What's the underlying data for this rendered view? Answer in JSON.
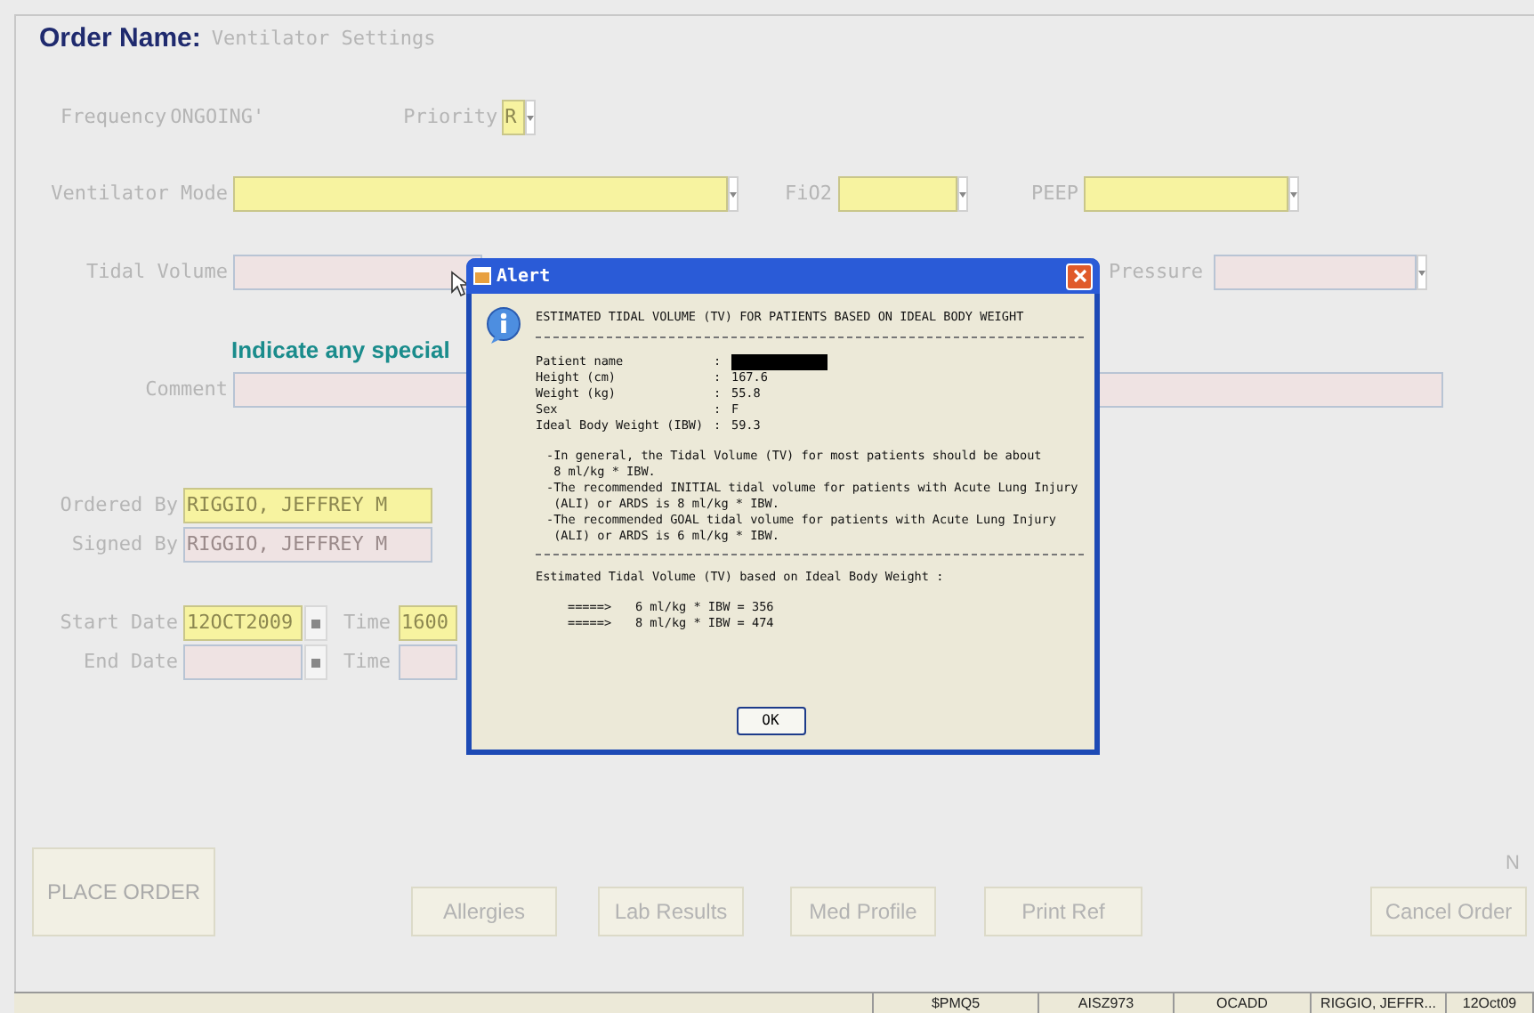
{
  "order_name": {
    "label": "Order Name:",
    "value": "Ventilator Settings"
  },
  "frequency": {
    "label": "Frequency",
    "value": "ONGOING'"
  },
  "priority": {
    "label": "Priority",
    "value": "R",
    "required": true
  },
  "ventilator_row": [
    {
      "label": "Ventilator Mode",
      "required": true,
      "kind": "dropdown"
    },
    {
      "label": "FiO2",
      "required": true,
      "kind": "dropdown"
    },
    {
      "label": "PEEP",
      "required": true,
      "kind": "dropdown"
    }
  ],
  "tidal_volume": {
    "label": "Tidal Volume",
    "required": false
  },
  "pressure": {
    "label": "Pressure",
    "required": false
  },
  "instruction": "Indicate any special",
  "comment": {
    "label": "Comment",
    "required": false
  },
  "ordered_by": {
    "label": "Ordered By",
    "value": "RIGGIO, JEFFREY M",
    "required": true
  },
  "signed_by": {
    "label": "Signed By",
    "value": "RIGGIO, JEFFREY M",
    "required": false
  },
  "dates": [
    {
      "label": "Start Date",
      "value": "12OCT2009",
      "required": true,
      "time_label": "Time",
      "time_value": "1600",
      "time_required": true
    },
    {
      "label": "End Date",
      "required": false,
      "time_label": "Time",
      "time_required": false
    }
  ],
  "place_order": "PLACE ORDER",
  "buttons": [
    "Allergies",
    "Lab Results",
    "Med Profile",
    "Print Ref"
  ],
  "n_marker": "N",
  "cancel": "Cancel Order",
  "status_bar": [
    "$PMQ5",
    "AISZ973",
    "OCADD",
    "RIGGIO, JEFFR...",
    "12Oct09"
  ],
  "alert": {
    "title": "Alert",
    "heading": "ESTIMATED TIDAL VOLUME (TV) FOR PATIENTS BASED ON IDEAL BODY WEIGHT",
    "info": [
      {
        "label": "Patient name",
        "separator": ":",
        "kind": "redacted"
      },
      {
        "label": "Height (cm)",
        "separator": ":",
        "value": "167.6",
        "kind": "text"
      },
      {
        "label": "Weight (kg)",
        "separator": ":",
        "value": "55.8",
        "kind": "text"
      },
      {
        "label": "Sex",
        "separator": ":",
        "value": "F",
        "kind": "text"
      },
      {
        "label": "Ideal Body Weight (IBW)",
        "separator": ":",
        "value": "59.3",
        "kind": "text"
      }
    ],
    "notes": [
      "-In general, the Tidal Volume (TV) for most patients should be about\n 8 ml/kg * IBW.",
      "-The recommended INITIAL tidal volume for patients with Acute Lung Injury\n (ALI) or ARDS is 8 ml/kg * IBW.",
      "-The recommended GOAL tidal volume for patients with Acute Lung Injury\n (ALI) or ARDS is 6 ml/kg * IBW."
    ],
    "summary": "Estimated Tidal Volume (TV) based on Ideal Body Weight :",
    "results": [
      {
        "arrow": "=====>",
        "text": "6 ml/kg * IBW = 356"
      },
      {
        "arrow": "=====>",
        "text": "8 ml/kg * IBW = 474"
      }
    ],
    "ok": "OK"
  }
}
